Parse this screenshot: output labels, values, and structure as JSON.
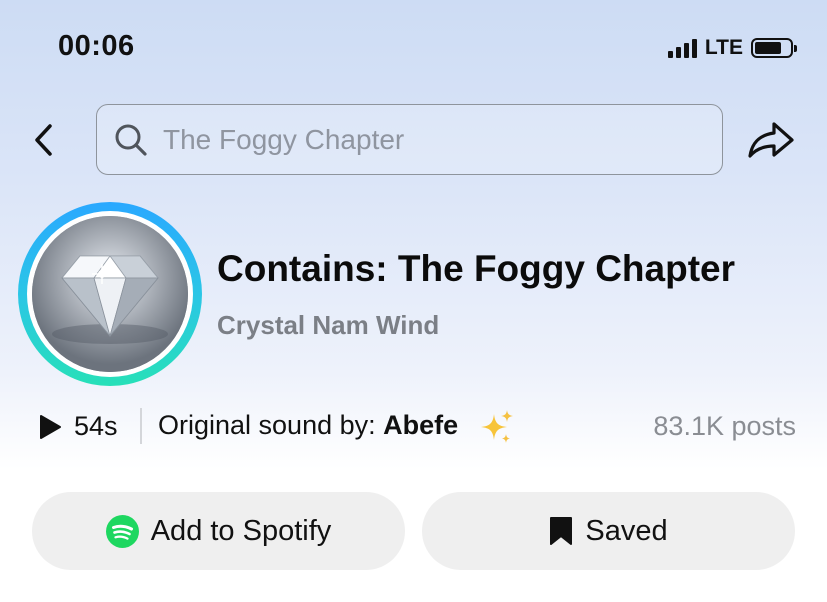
{
  "status_bar": {
    "time": "00:06",
    "network": "LTE"
  },
  "search": {
    "placeholder": "The Foggy Chapter"
  },
  "sound": {
    "title": "Contains: The Foggy Chapter",
    "artist": "Crystal Nam Wind",
    "duration": "54s",
    "original_prefix": "Original sound by: ",
    "original_user": "Abefe",
    "posts": "83.1K posts"
  },
  "actions": {
    "spotify_label": "Add to Spotify",
    "saved_label": "Saved"
  },
  "icons": [
    "back-icon",
    "search-icon",
    "share-icon",
    "play-icon",
    "sparkles-icon",
    "spotify-icon",
    "bookmark-icon"
  ],
  "colors": {
    "ring_start": "#2aa8ff",
    "ring_end": "#27e0b8",
    "spotify_green": "#1ed760",
    "button_bg": "#efefef"
  }
}
